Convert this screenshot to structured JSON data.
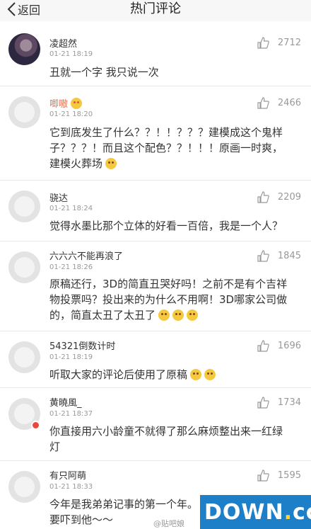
{
  "nav": {
    "back_label": "返回",
    "title": "热门评论"
  },
  "comments": [
    {
      "name": "凌超然",
      "time": "01-21 18:19",
      "likes": "2712",
      "lines": [
        "丑就一个字 我只说一次"
      ]
    },
    {
      "name": "唧嗷",
      "time": "01-21 18:20",
      "likes": "2466",
      "lines": [
        "它到底发生了什么？？！！？？？建模成这个鬼样",
        "子？？？！而且这个配色？？！！！原画一时爽，",
        "建模火葬场"
      ]
    },
    {
      "name": "骁达",
      "time": "01-21 18:24",
      "likes": "2209",
      "lines": [
        "觉得水墨比那个立体的好看一百倍，我是一个人？"
      ]
    },
    {
      "name": "六六六不能再浪了",
      "time": "01-21 18:26",
      "likes": "1845",
      "lines": [
        "原稿还行，3D的简直丑哭好吗！之前不是有个吉祥",
        "物投票吗？投出来的为什么不用啊！3D哪家公司做",
        "的，简直太丑了太丑了"
      ]
    },
    {
      "name": "54321倒数计时",
      "time": "01-21 18:19",
      "likes": "1696",
      "lines": [
        "听取大家的评论后使用了原稿"
      ]
    },
    {
      "name": "黄曉風_",
      "time": "01-21 18:37",
      "likes": "1734",
      "lines": [
        "你直接用六小龄童不就得了那么麻烦整出来一红绿",
        "灯"
      ]
    },
    {
      "name": "有只阿萌",
      "time": "01-21 18:33",
      "likes": "1595",
      "lines": [
        "今年是我弟弟记事的第一个年。",
        "要吓到他～～"
      ]
    }
  ],
  "watermark": {
    "weibo": "@贴吧娘",
    "logo_main": "DOWN",
    "logo_dot": ".",
    "logo_tld": "cc"
  },
  "colors": {
    "accent_name": "#eb7350",
    "logo_bg": "#1d7fc7"
  }
}
